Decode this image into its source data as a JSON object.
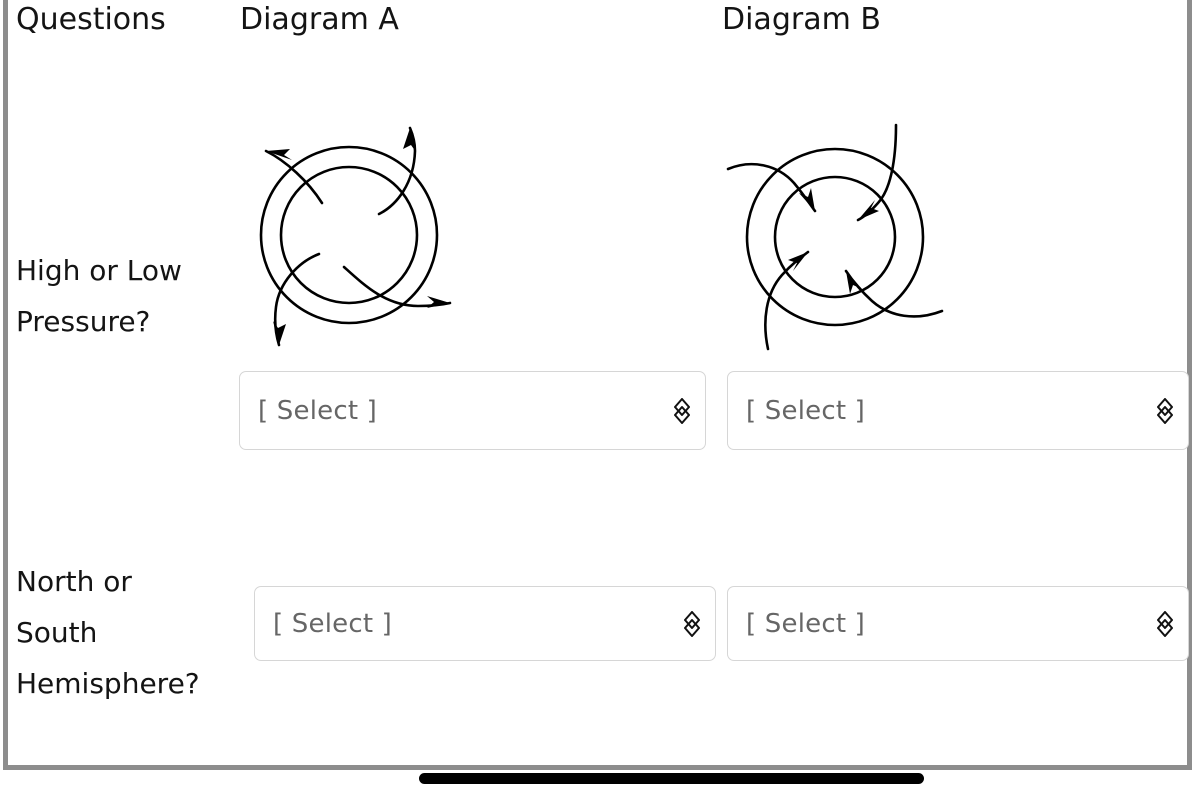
{
  "table": {
    "headers": {
      "questions": "Questions",
      "diagram_a": "Diagram A",
      "diagram_b": "Diagram B"
    },
    "rows": [
      {
        "question": "High or Low Pressure?",
        "question_line1": "High or Low",
        "question_line2": "Pressure?",
        "diagram_a": {
          "name": "diagram-a-spiral-outflow",
          "description": "Two concentric circles with four spiral arms whose arrowheads point outward, away from the center",
          "arrow_direction": "outward",
          "rotation": "clockwise"
        },
        "diagram_b": {
          "name": "diagram-b-spiral-inflow",
          "description": "Two concentric circles with four spiral arms whose arrowheads point inward, toward the center",
          "arrow_direction": "inward",
          "rotation": "clockwise"
        },
        "answer_a": {
          "value": "[ Select ]",
          "placeholder": "[ Select ]"
        },
        "answer_b": {
          "value": "[ Select ]",
          "placeholder": "[ Select ]"
        }
      },
      {
        "question": "North or South Hemisphere?",
        "question_line1": "North or",
        "question_line2": "South",
        "question_line3": "Hemisphere?",
        "answer_a": {
          "value": "[ Select ]",
          "placeholder": "[ Select ]"
        },
        "answer_b": {
          "value": "[ Select ]",
          "placeholder": "[ Select ]"
        }
      }
    ]
  },
  "icons": {
    "select_chevron": "chevron-up-down-icon"
  },
  "colors": {
    "card_border": "#8d8d8d",
    "select_border": "#d6d6d6",
    "placeholder_text": "#666666",
    "body_text": "#141414",
    "diagram_stroke": "#000000",
    "home_indicator": "#000000",
    "background": "#ffffff"
  },
  "system": {
    "home_indicator": "home-indicator-bar"
  }
}
